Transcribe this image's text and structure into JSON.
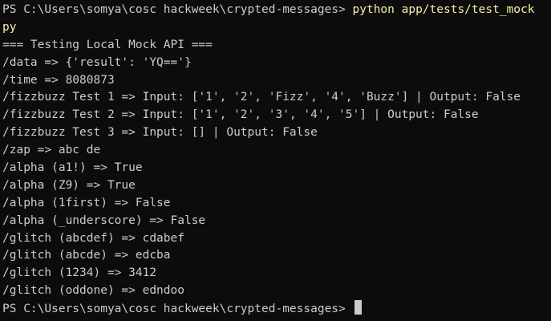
{
  "terminal": {
    "colors": {
      "background": "#0c0c0c",
      "foreground": "#cccccc",
      "command": "#f9f1a5"
    },
    "prompt": "PS C:\\Users\\somya\\cosc hackweek\\crypted-messages> ",
    "command": "python app/tests/test_mock",
    "command_wrap": "py",
    "output_lines": [
      "=== Testing Local Mock API ===",
      "/data => {'result': 'YQ=='}",
      "/time => 8080873",
      "/fizzbuzz Test 1 => Input: ['1', '2', 'Fizz', '4', 'Buzz'] | Output: False",
      "/fizzbuzz Test 2 => Input: ['1', '2', '3', '4', '5'] | Output: False",
      "/fizzbuzz Test 3 => Input: [] | Output: False",
      "/zap => abc de",
      "/alpha (a1!) => True",
      "/alpha (Z9) => True",
      "/alpha (1first) => False",
      "/alpha (_underscore) => False",
      "/glitch (abcdef) => cdabef",
      "/glitch (abcde) => edcba",
      "/glitch (1234) => 3412",
      "/glitch (oddone) => edndoo"
    ],
    "final_prompt": "PS C:\\Users\\somya\\cosc hackweek\\crypted-messages> "
  }
}
